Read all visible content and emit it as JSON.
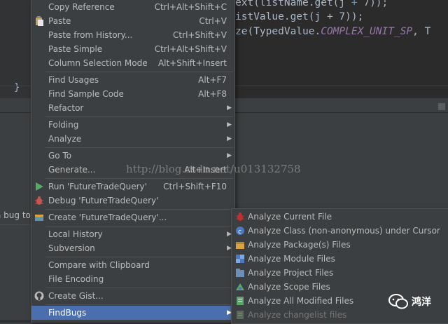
{
  "editor": {
    "line1_a": "ext(listName.get(j ",
    "line1_b": "+",
    "line1_c": " 7));",
    "line2_a": "istValue.get(j ",
    "line2_b": "+",
    "line2_c": " 7));",
    "line3_a": "ze(TypedValue.",
    "line3_const": "COMPLEX_UNIT_SP",
    "line3_b": ", T",
    "brace": "}"
  },
  "background_text": "a bug to",
  "context_menu": {
    "items": [
      {
        "label": "Copy Reference",
        "shortcut": "Ctrl+Alt+Shift+C"
      },
      {
        "label": "Paste",
        "shortcut": "Ctrl+V"
      },
      {
        "label": "Paste from History...",
        "shortcut": "Ctrl+Shift+V"
      },
      {
        "label": "Paste Simple",
        "shortcut": "Ctrl+Alt+Shift+V"
      },
      {
        "label": "Column Selection Mode",
        "shortcut": "Alt+Shift+Insert"
      },
      {
        "label": "Find Usages",
        "shortcut": "Alt+F7"
      },
      {
        "label": "Find Sample Code",
        "shortcut": "Alt+F8"
      },
      {
        "label": "Refactor"
      },
      {
        "label": "Folding"
      },
      {
        "label": "Analyze"
      },
      {
        "label": "Go To"
      },
      {
        "label": "Generate...",
        "shortcut": "Alt+Insert"
      },
      {
        "label": "Run 'FutureTradeQuery'",
        "shortcut": "Ctrl+Shift+F10"
      },
      {
        "label": "Debug 'FutureTradeQuery'"
      },
      {
        "label": "Create 'FutureTradeQuery'..."
      },
      {
        "label": "Local History"
      },
      {
        "label": "Subversion"
      },
      {
        "label": "Compare with Clipboard"
      },
      {
        "label": "File Encoding"
      },
      {
        "label": "Create Gist..."
      },
      {
        "label": "FindBugs"
      }
    ]
  },
  "findbugs_submenu": {
    "items": [
      {
        "label": "Analyze Current File"
      },
      {
        "label": "Analyze Class (non-anonymous) under Cursor"
      },
      {
        "label": "Analyze Package(s) Files"
      },
      {
        "label": "Analyze Module Files"
      },
      {
        "label": "Analyze Project Files"
      },
      {
        "label": "Analyze Scope Files"
      },
      {
        "label": "Analyze All Modified Files"
      },
      {
        "label": "Analyze changelist files"
      }
    ]
  },
  "watermark": "http://blog.csdn.net/u013132758",
  "wechat_label": "鸿洋",
  "colors": {
    "menu_bg": "#3c3f41",
    "selection": "#4b6eaf",
    "editor_bg": "#2b2b2b",
    "text": "#bbbbbb",
    "disabled_text": "#777777"
  }
}
